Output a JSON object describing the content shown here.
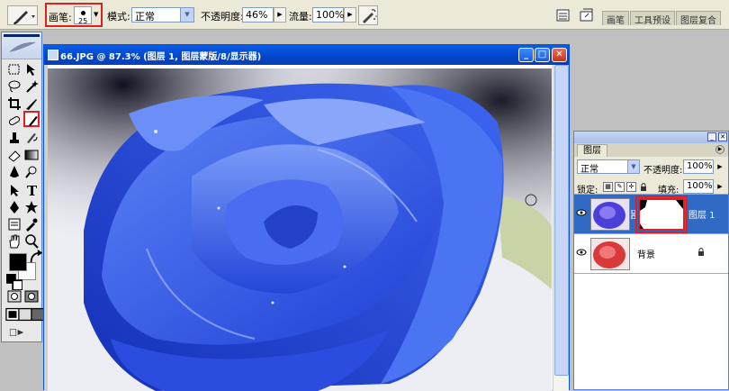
{
  "options_bar": {
    "brush_label": "画笔:",
    "brush_size": "25",
    "mode_label": "模式:",
    "mode_value": "正常",
    "opacity_label": "不透明度:",
    "opacity_value": "46%",
    "flow_label": "流量:",
    "flow_value": "100%",
    "well_tabs": [
      "画笔",
      "工具预设",
      "图层复合"
    ]
  },
  "document": {
    "title": "66.JPG @ 87.3% (图层 1, 图层蒙版/8/显示器)"
  },
  "layers_panel": {
    "tab": "图层",
    "blend_mode": "正常",
    "opacity_label": "不透明度:",
    "opacity_value": "100%",
    "lock_label": "锁定:",
    "fill_label": "填充:",
    "fill_value": "100%",
    "layers": [
      {
        "name": "图层 1",
        "active": true
      },
      {
        "name": "背景",
        "active": false
      }
    ]
  },
  "colors": {
    "highlight": "#e02020",
    "title_blue": "#0246c9",
    "layer_selected": "#316ac5"
  }
}
